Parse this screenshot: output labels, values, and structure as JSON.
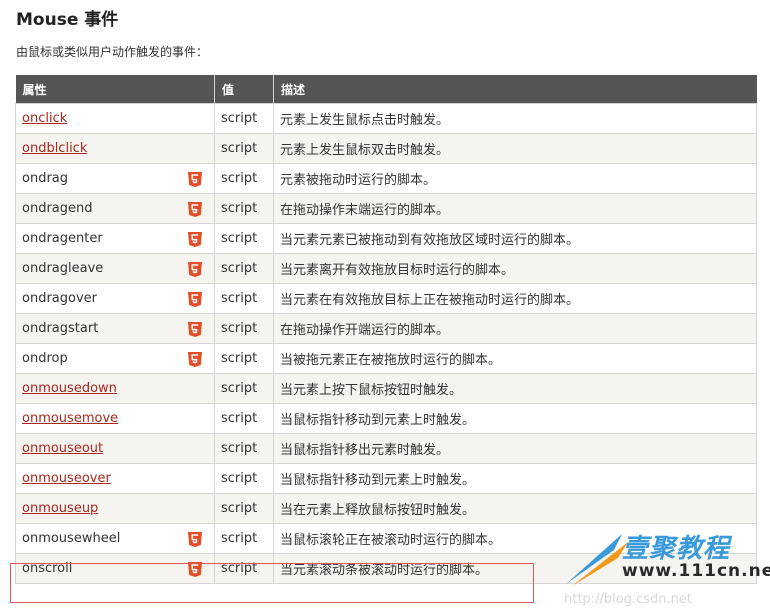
{
  "page": {
    "title": "Mouse 事件",
    "subtitle": "由鼠标或类似用户动作触发的事件："
  },
  "table": {
    "headers": {
      "attr": "属性",
      "value": "值",
      "desc": "描述"
    },
    "rows": [
      {
        "attr": "onclick",
        "link": true,
        "html5": false,
        "value": "script",
        "desc": "元素上发生鼠标点击时触发。"
      },
      {
        "attr": "ondblclick",
        "link": true,
        "html5": false,
        "value": "script",
        "desc": "元素上发生鼠标双击时触发。"
      },
      {
        "attr": "ondrag",
        "link": false,
        "html5": true,
        "value": "script",
        "desc": "元素被拖动时运行的脚本。"
      },
      {
        "attr": "ondragend",
        "link": false,
        "html5": true,
        "value": "script",
        "desc": "在拖动操作末端运行的脚本。"
      },
      {
        "attr": "ondragenter",
        "link": false,
        "html5": true,
        "value": "script",
        "desc": "当元素元素已被拖动到有效拖放区域时运行的脚本。"
      },
      {
        "attr": "ondragleave",
        "link": false,
        "html5": true,
        "value": "script",
        "desc": "当元素离开有效拖放目标时运行的脚本。"
      },
      {
        "attr": "ondragover",
        "link": false,
        "html5": true,
        "value": "script",
        "desc": "当元素在有效拖放目标上正在被拖动时运行的脚本。"
      },
      {
        "attr": "ondragstart",
        "link": false,
        "html5": true,
        "value": "script",
        "desc": "在拖动操作开端运行的脚本。"
      },
      {
        "attr": "ondrop",
        "link": false,
        "html5": true,
        "value": "script",
        "desc": "当被拖元素正在被拖放时运行的脚本。"
      },
      {
        "attr": "onmousedown",
        "link": true,
        "html5": false,
        "value": "script",
        "desc": "当元素上按下鼠标按钮时触发。"
      },
      {
        "attr": "onmousemove",
        "link": true,
        "html5": false,
        "value": "script",
        "desc": "当鼠标指针移动到元素上时触发。"
      },
      {
        "attr": "onmouseout",
        "link": true,
        "html5": false,
        "value": "script",
        "desc": "当鼠标指针移出元素时触发。"
      },
      {
        "attr": "onmouseover",
        "link": true,
        "html5": false,
        "value": "script",
        "desc": "当鼠标指针移动到元素上时触发。"
      },
      {
        "attr": "onmouseup",
        "link": true,
        "html5": false,
        "value": "script",
        "desc": "当在元素上释放鼠标按钮时触发。"
      },
      {
        "attr": "onmousewheel",
        "link": false,
        "html5": true,
        "value": "script",
        "desc": "当鼠标滚轮正在被滚动时运行的脚本。"
      },
      {
        "attr": "onscroll",
        "link": false,
        "html5": true,
        "value": "script",
        "desc": "当元素滚动条被滚动时运行的脚本。"
      }
    ]
  },
  "watermark": {
    "logo_text": "壹聚教程",
    "site": "www.111cn.net",
    "url": "http://blog.csdn.net"
  },
  "colors": {
    "header_bg": "#555555",
    "link": "#a7281f",
    "html5_badge": "#e44d26",
    "highlight_border": "#e05a5a",
    "stripe": "#f6f4f0"
  },
  "icons": {
    "html5_badge": "html5-icon"
  }
}
